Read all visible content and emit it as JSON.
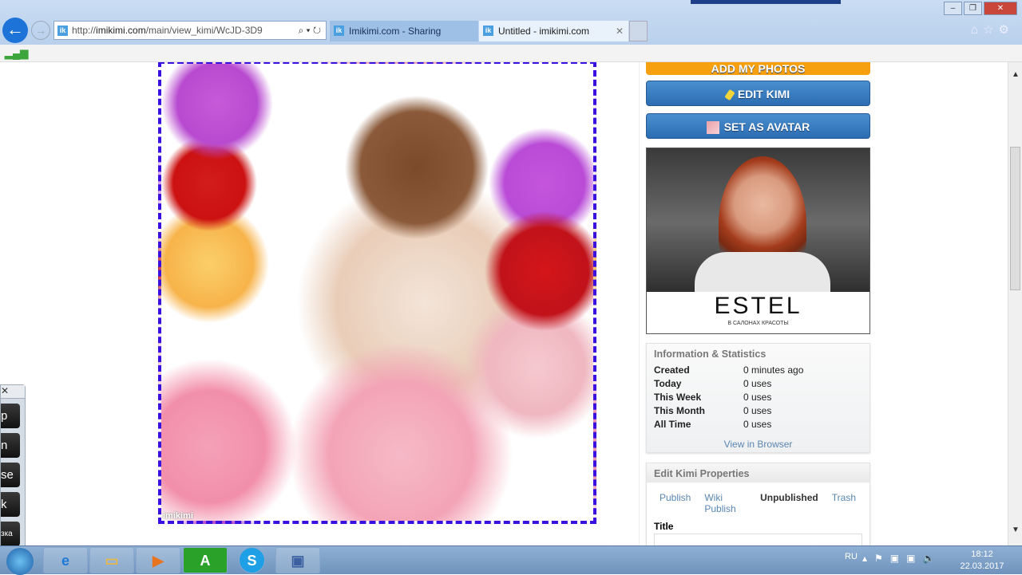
{
  "browser": {
    "url_prefix": "http://",
    "url_domain": "imikimi.com",
    "url_path": "/main/view_kimi/WcJD-3D9",
    "tabs": [
      {
        "label": "Imikimi.com - Sharing Creativity",
        "active": false
      },
      {
        "label": "Untitled - imikimi.com",
        "active": true
      }
    ],
    "favicon": "ik"
  },
  "kimi": {
    "watermark": "imikimi"
  },
  "sidebar": {
    "add_photos_label": "ADD MY PHOTOS",
    "edit_kimi_label": "EDIT KIMI",
    "set_avatar_label": "SET AS AVATAR",
    "ad": {
      "brand": "ESTEL",
      "tagline": "В САЛОНАХ КРАСОТЫ"
    },
    "info": {
      "title": "Information & Statistics",
      "rows": [
        {
          "label": "Created",
          "value": "0 minutes ago"
        },
        {
          "label": "Today",
          "value": "0 uses"
        },
        {
          "label": "This Week",
          "value": "0 uses"
        },
        {
          "label": "This Month",
          "value": "0 uses"
        },
        {
          "label": "All Time",
          "value": "0 uses"
        }
      ],
      "view_in_browser": "View in Browser"
    },
    "props": {
      "title": "Edit Kimi Properties",
      "tabs": [
        "Publish",
        "Wiki Publish",
        "Unpublished",
        "Trash"
      ],
      "active_tab": "Unpublished",
      "title_label": "Title",
      "title_value": ""
    }
  },
  "osk": {
    "keys": [
      "p",
      "n",
      "se",
      "k",
      "зка"
    ]
  },
  "taskbar": {
    "apps": [
      "internet-explorer",
      "file-explorer",
      "media-player",
      "A",
      "S",
      "remote-desktop"
    ],
    "language": "RU",
    "time": "18:12",
    "date": "22.03.2017"
  }
}
